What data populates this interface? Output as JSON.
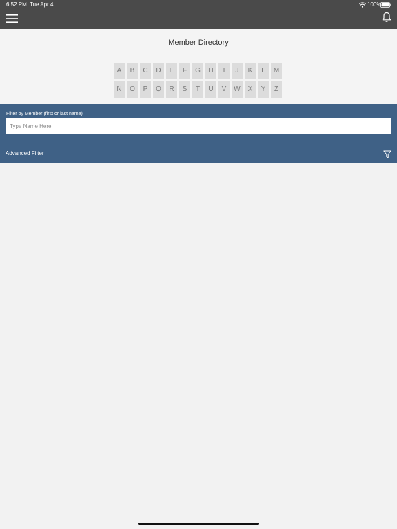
{
  "status_bar": {
    "time": "6:52 PM",
    "date": "Tue Apr 4",
    "battery": "100%"
  },
  "nav": {
    "title": "Member Directory"
  },
  "alphabet": {
    "row1": [
      "A",
      "B",
      "C",
      "D",
      "E",
      "F",
      "G",
      "H",
      "I",
      "J",
      "K",
      "L",
      "M"
    ],
    "row2": [
      "N",
      "O",
      "P",
      "Q",
      "R",
      "S",
      "T",
      "U",
      "V",
      "W",
      "X",
      "Y",
      "Z"
    ]
  },
  "filter": {
    "label": "Filter by Member (first or last name)",
    "value": "",
    "placeholder": "Type Name Here",
    "advanced_label": "Advanced Filter"
  },
  "colors": {
    "topbar": "#4a4a4a",
    "accent": "#3f6186",
    "background": "#f2f2f2"
  }
}
